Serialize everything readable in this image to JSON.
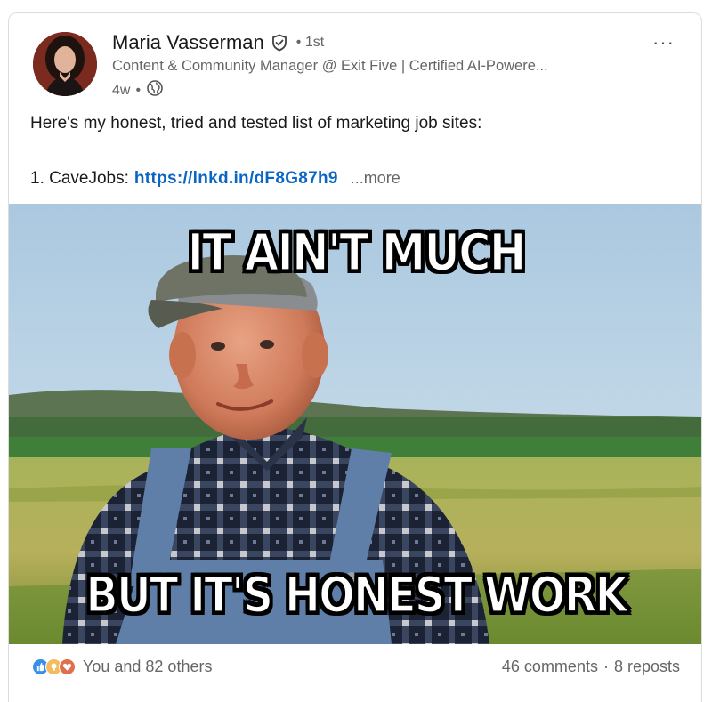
{
  "post": {
    "author": {
      "name": "Maria Vasserman",
      "degree": "1st",
      "headline": "Content & Community Manager @ Exit Five | Certified AI-Powere...",
      "time": "4w",
      "bullet": "•",
      "visibility_icon": "globe-icon",
      "verified_icon": "verified-shield-icon"
    },
    "menu_label": "···",
    "text_line1": "Here's my honest, tried and tested list of marketing job sites:",
    "list_item_prefix": "1. CaveJobs:",
    "link_text": "https://lnkd.in/dF8G87h9",
    "see_more": "...more",
    "meme": {
      "top_text": "IT AIN'T MUCH",
      "bottom_text": "BUT IT'S HONEST WORK"
    },
    "social": {
      "reactions_text": "You and 82 others",
      "reaction_icons": [
        "like-icon",
        "insightful-icon",
        "love-icon"
      ],
      "comments": "46 comments",
      "separator": "·",
      "reposts": "8 reposts"
    }
  },
  "colors": {
    "link": "#0a66c2",
    "muted": "#666666",
    "like": "#378fe9",
    "insightful": "#f5bb5c",
    "love": "#df704d"
  }
}
